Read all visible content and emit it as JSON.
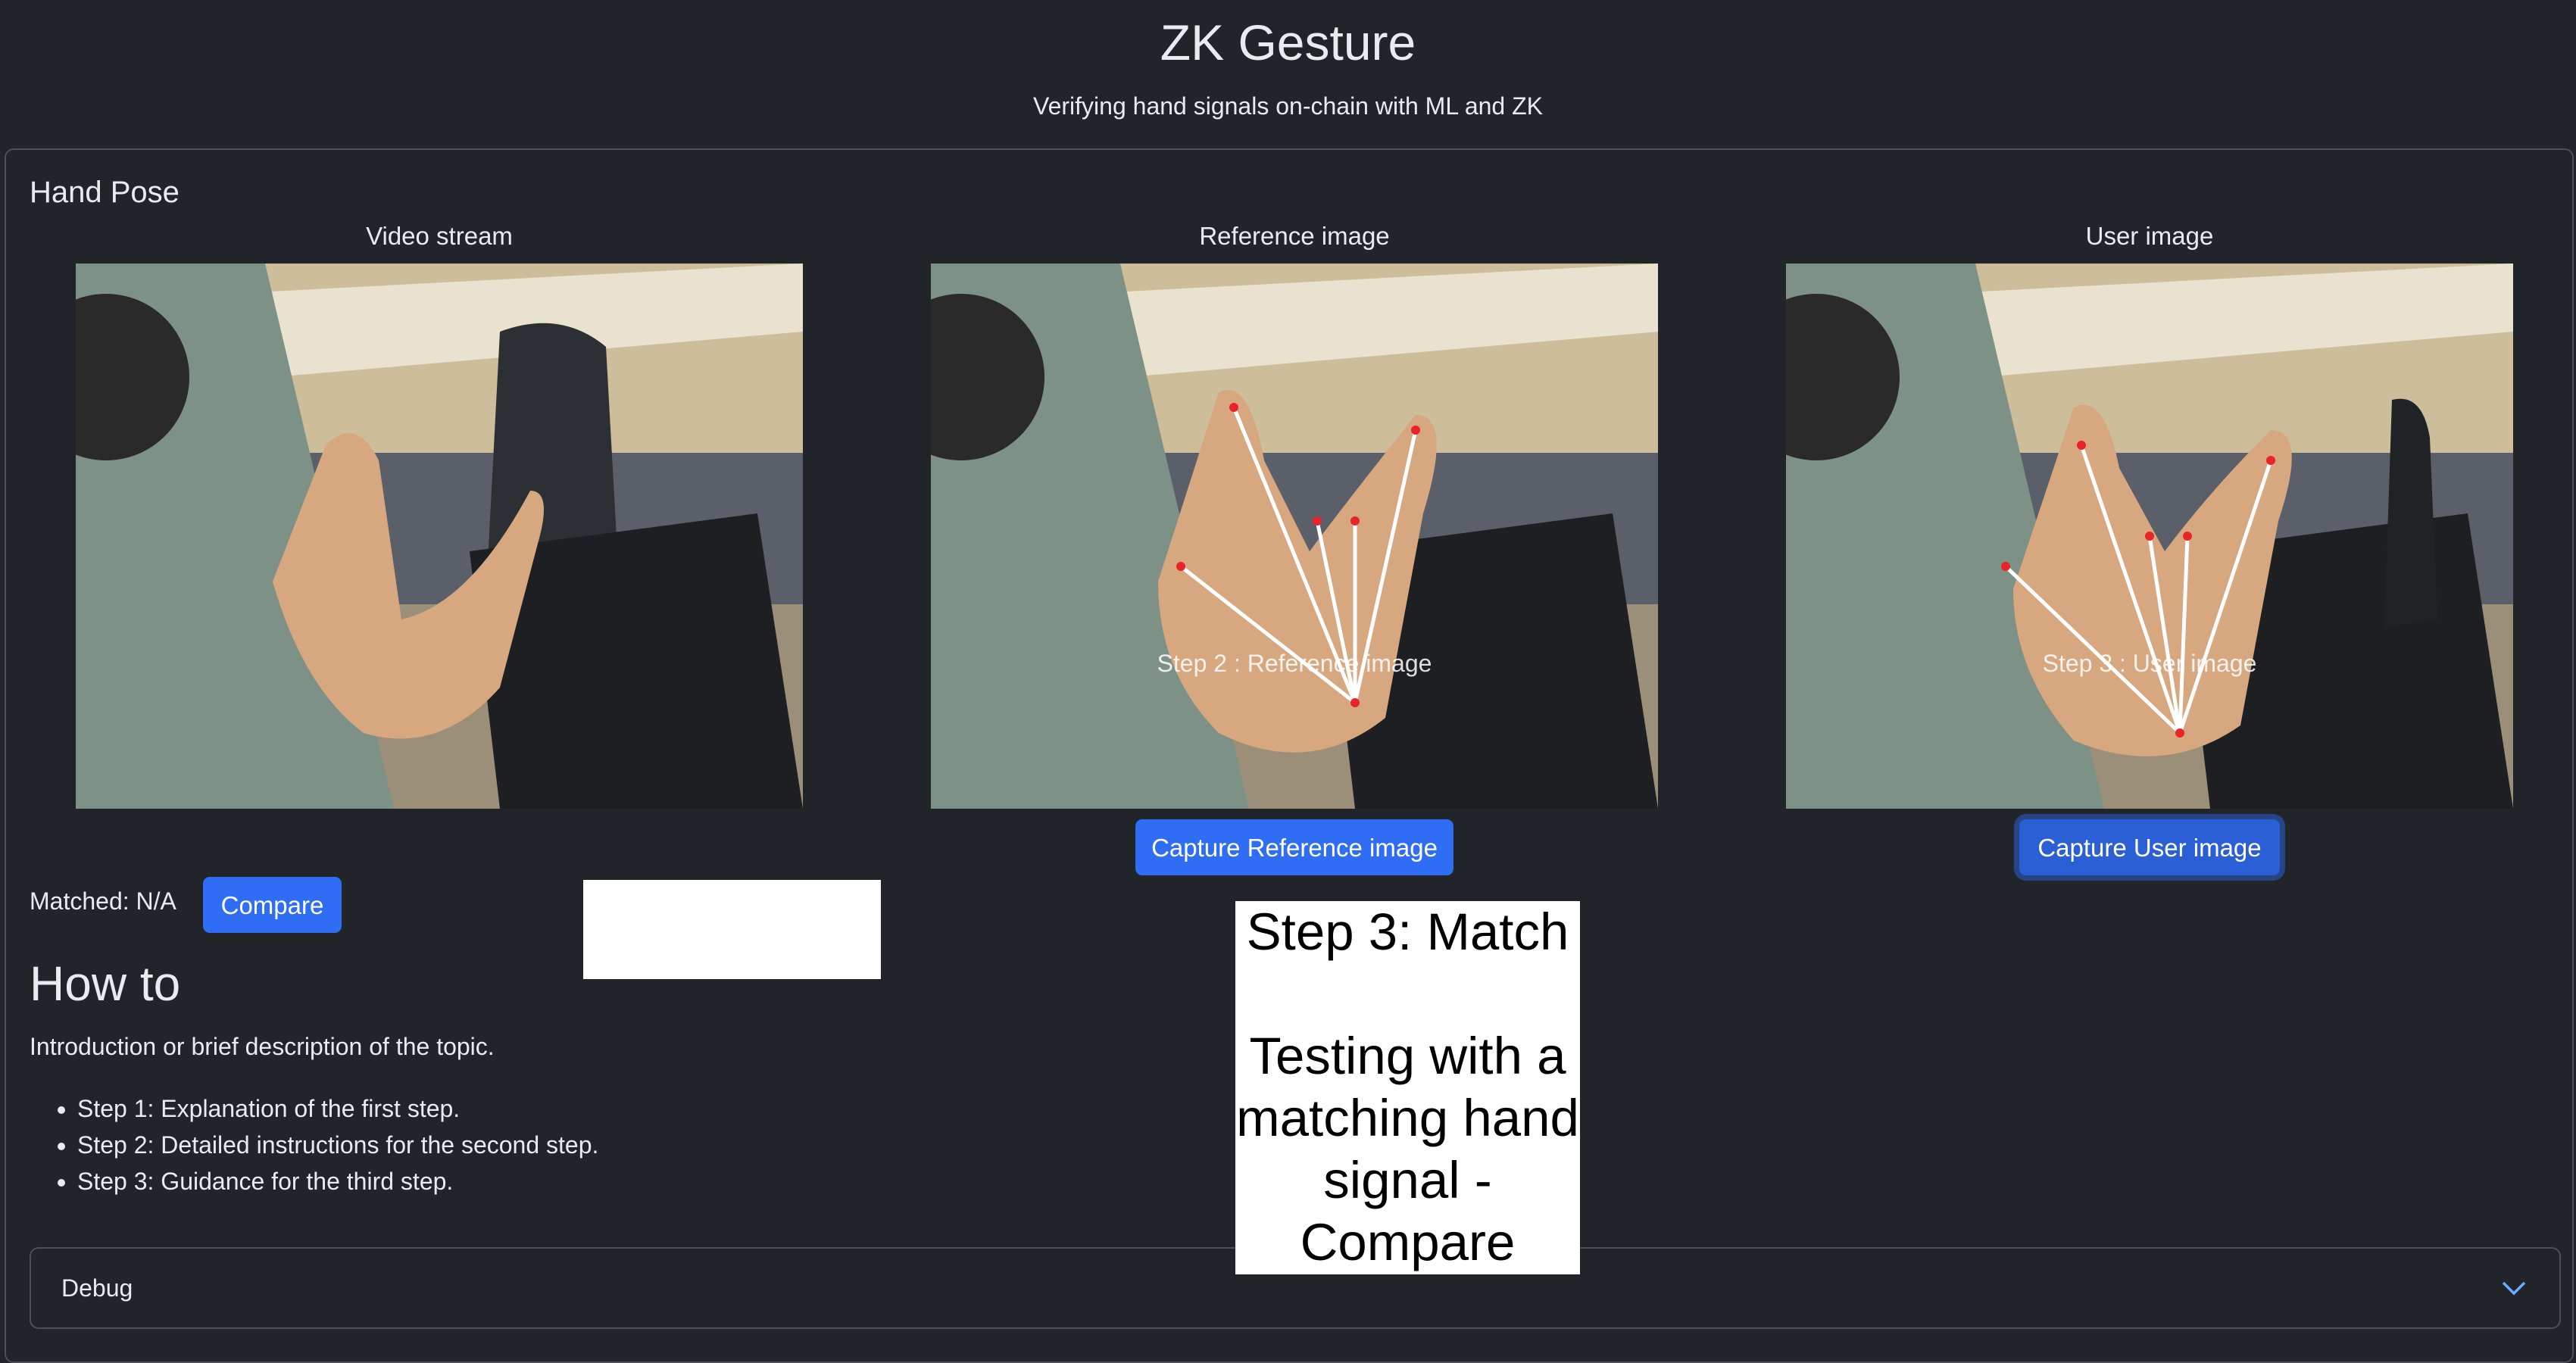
{
  "header": {
    "title": "ZK Gesture",
    "subtitle": "Verifying hand signals on-chain with ML and ZK"
  },
  "card": {
    "title": "Hand Pose",
    "columns": [
      {
        "title": "Video stream",
        "overlay": ""
      },
      {
        "title": "Reference image",
        "overlay": "Step 2 : Reference image",
        "button": "Capture Reference image"
      },
      {
        "title": "User image",
        "overlay": "Step 3 : User image",
        "button": "Capture User image"
      }
    ]
  },
  "compare": {
    "matched_label": "Matched: N/A",
    "button": "Compare"
  },
  "howto": {
    "title": "How to",
    "intro": "Introduction or brief description of the topic.",
    "steps": [
      "Step 1: Explanation of the first step.",
      "Step 2: Detailed instructions for the second step.",
      "Step 3: Guidance for the third step."
    ]
  },
  "debug": {
    "label": "Debug",
    "icon": "chevron-down-icon"
  },
  "caption": {
    "text": "Step 3: Match\n\nTesting with a matching hand signal -Compare"
  },
  "colors": {
    "background": "#212529",
    "primary": "#2f6df5",
    "border": "#495057"
  }
}
